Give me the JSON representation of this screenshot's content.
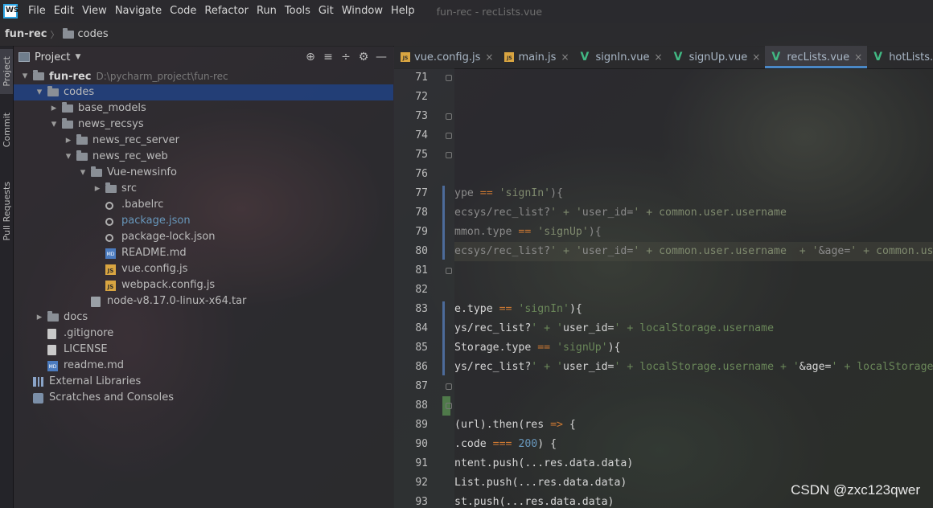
{
  "menu": {
    "logo": "WS",
    "items": [
      "File",
      "Edit",
      "View",
      "Navigate",
      "Code",
      "Refactor",
      "Run",
      "Tools",
      "Git",
      "Window",
      "Help"
    ],
    "window_title": "fun-rec - recLists.vue"
  },
  "breadcrumb": {
    "root": "fun-rec",
    "child": "codes"
  },
  "toolstrip": {
    "project": "Project",
    "commit": "Commit",
    "pull_requests": "Pull Requests"
  },
  "project_panel": {
    "title": "Project",
    "tree": [
      {
        "label": "fun-rec",
        "path": "D:\\pycharm_project\\fun-rec",
        "depth": 0,
        "arrow": "down",
        "icon": "folder",
        "bold": true
      },
      {
        "label": "codes",
        "depth": 1,
        "arrow": "down",
        "icon": "folder",
        "selected": true
      },
      {
        "label": "base_models",
        "depth": 2,
        "arrow": "right",
        "icon": "folder"
      },
      {
        "label": "news_recsys",
        "depth": 2,
        "arrow": "down",
        "icon": "folder"
      },
      {
        "label": "news_rec_server",
        "depth": 3,
        "arrow": "right",
        "icon": "folder"
      },
      {
        "label": "news_rec_web",
        "depth": 3,
        "arrow": "down",
        "icon": "folder"
      },
      {
        "label": "Vue-newsinfo",
        "depth": 4,
        "arrow": "down",
        "icon": "folder"
      },
      {
        "label": "src",
        "depth": 5,
        "arrow": "right",
        "icon": "folder"
      },
      {
        "label": ".babelrc",
        "depth": 5,
        "icon": "gear"
      },
      {
        "label": "package.json",
        "depth": 5,
        "icon": "gear",
        "modified": true
      },
      {
        "label": "package-lock.json",
        "depth": 5,
        "icon": "gear"
      },
      {
        "label": "README.md",
        "depth": 5,
        "icon": "md"
      },
      {
        "label": "vue.config.js",
        "depth": 5,
        "icon": "js"
      },
      {
        "label": "webpack.config.js",
        "depth": 5,
        "icon": "js"
      },
      {
        "label": "node-v8.17.0-linux-x64.tar",
        "depth": 4,
        "icon": "tar"
      },
      {
        "label": "docs",
        "depth": 1,
        "arrow": "right",
        "icon": "folder"
      },
      {
        "label": ".gitignore",
        "depth": 1,
        "icon": "file"
      },
      {
        "label": "LICENSE",
        "depth": 1,
        "icon": "file"
      },
      {
        "label": "readme.md",
        "depth": 1,
        "icon": "md"
      },
      {
        "label": "External Libraries",
        "depth": 0,
        "arrow": "none",
        "icon": "lib"
      },
      {
        "label": "Scratches and Consoles",
        "depth": 0,
        "arrow": "none",
        "icon": "scratch"
      }
    ]
  },
  "tabs": [
    {
      "label": "vue.config.js",
      "type": "js"
    },
    {
      "label": "main.js",
      "type": "js"
    },
    {
      "label": "signIn.vue",
      "type": "vue"
    },
    {
      "label": "signUp.vue",
      "type": "vue"
    },
    {
      "label": "recLists.vue",
      "type": "vue",
      "active": true
    },
    {
      "label": "hotLists.vue",
      "type": "vue"
    }
  ],
  "editor": {
    "lines": [
      {
        "n": "71",
        "text": ""
      },
      {
        "n": "72",
        "text": ""
      },
      {
        "n": "73",
        "text": ""
      },
      {
        "n": "74",
        "text": ""
      },
      {
        "n": "75",
        "text": ""
      },
      {
        "n": "76",
        "text": ""
      },
      {
        "n": "77",
        "text": "ype == 'signIn'){",
        "style": "dim"
      },
      {
        "n": "78",
        "text": "ecsys/rec_list?' + 'user_id=' + common.user.username",
        "style": "dim"
      },
      {
        "n": "79",
        "text": "mmon.type == 'signUp'){",
        "style": "dim"
      },
      {
        "n": "80",
        "text": "ecsys/rec_list?' + 'user_id=' + common.user.username  + '&age=' + common.user.age",
        "style": "dim",
        "current": true
      },
      {
        "n": "81",
        "text": ""
      },
      {
        "n": "82",
        "text": ""
      },
      {
        "n": "83",
        "text": "e.type == 'signIn'){",
        "style": "bright"
      },
      {
        "n": "84",
        "text": "ys/rec_list?' + 'user_id=' + localStorage.username",
        "style": "bright"
      },
      {
        "n": "85",
        "text": "Storage.type == 'signUp'){",
        "style": "bright"
      },
      {
        "n": "86",
        "text": "ys/rec_list?' + 'user_id=' + localStorage.username + '&age=' + localStorage.age",
        "style": "bright"
      },
      {
        "n": "87",
        "text": ""
      },
      {
        "n": "88",
        "text": ""
      },
      {
        "n": "89",
        "text": "(url).then(res => {",
        "style": "bright"
      },
      {
        "n": "90",
        "text": ".code === 200) {",
        "style": "bright"
      },
      {
        "n": "91",
        "text": "ntent.push(...res.data.data)",
        "style": "bright"
      },
      {
        "n": "92",
        "text": "List.push(...res.data.data)",
        "style": "bright"
      },
      {
        "n": "93",
        "text": "st.push(...res.data.data)",
        "style": "bright"
      }
    ]
  },
  "watermark": "CSDN @zxc123qwer"
}
